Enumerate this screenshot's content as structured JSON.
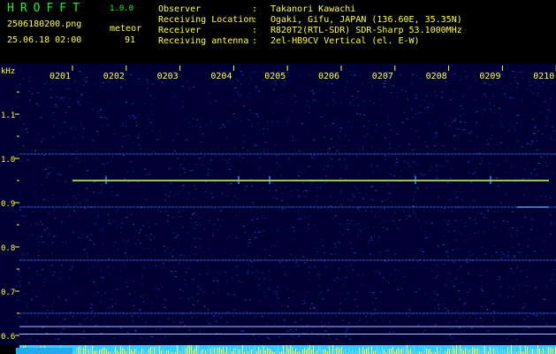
{
  "header": {
    "logo": "HROFFT",
    "version": "1.0.0",
    "filename": "2506180200.png",
    "datetime": "25.06.18 02:00",
    "meteor_label": "meteor",
    "meteor_count": "91",
    "fields": [
      {
        "label": "Observer",
        "value": "Takanori Kawachi"
      },
      {
        "label": "Receiving Location",
        "value": "Ogaki, Gifu, JAPAN (136.60E, 35.35N)"
      },
      {
        "label": "Receiver",
        "value": "R820T2(RTL-SDR) SDR-Sharp 53.1000MHz"
      },
      {
        "label": "Receiving antenna",
        "value": "2el-HB9CV Vertical (el. E-W)"
      }
    ],
    "separator": ":"
  },
  "spectrogram": {
    "y_unit": "kHz",
    "y_ticks": [
      "1.1",
      "1.0",
      "0.9",
      "0.8",
      "0.7",
      "0.6"
    ],
    "time_ticks": [
      "0201",
      "0202",
      "0203",
      "0204",
      "0205",
      "0206",
      "0207",
      "0208",
      "0209",
      "0210"
    ],
    "colors": {
      "background": "#000033",
      "signal": "#ffff66",
      "line": "#4477ff",
      "bottom_bar": "#33ccff"
    }
  }
}
